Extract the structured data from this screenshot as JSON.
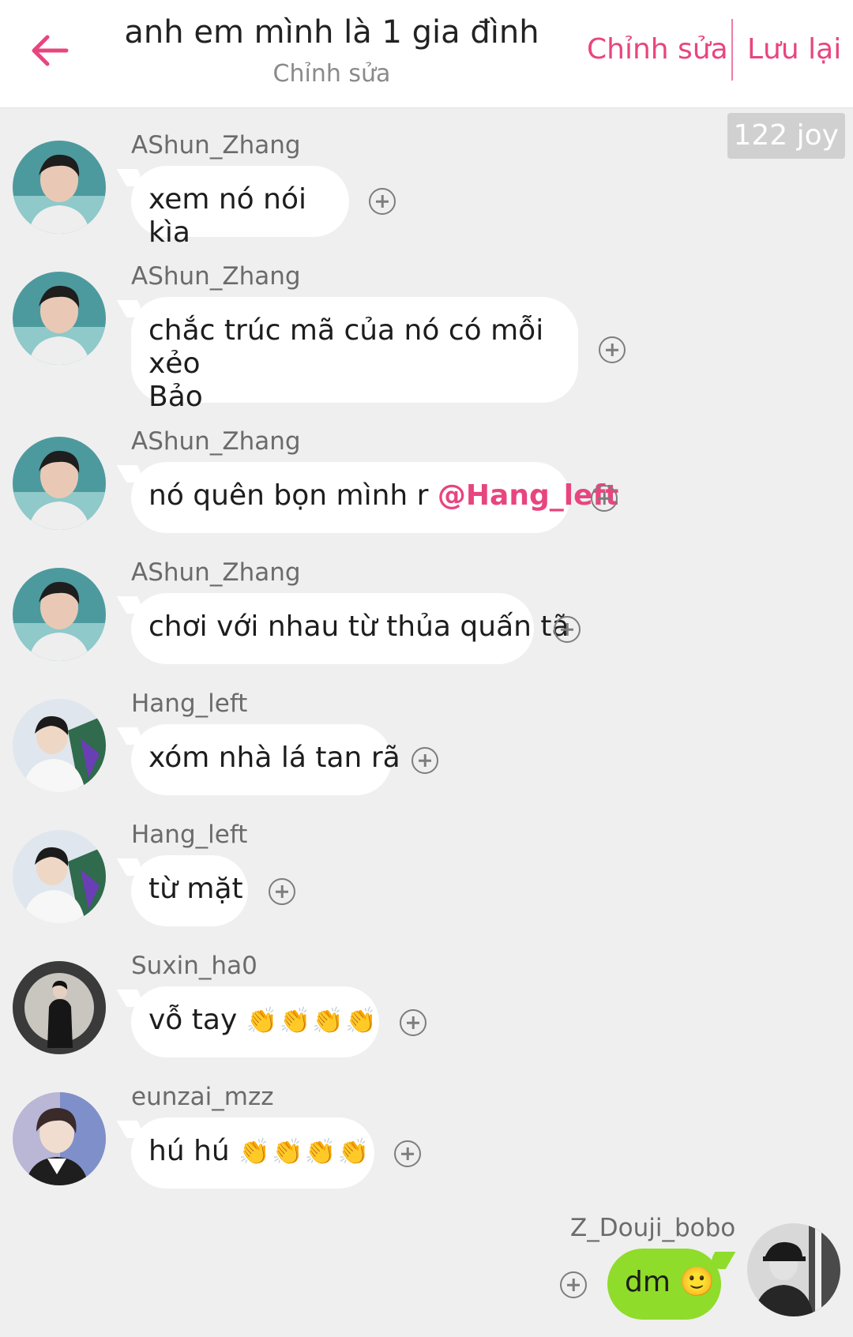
{
  "header": {
    "title": "anh em mình là 1 gia đình",
    "subtitle": "Chỉnh sửa",
    "edit_label": "Chỉnh sửa",
    "save_label": "Lưu lại",
    "back_icon": "arrow-left-icon",
    "accent": "#e8457f"
  },
  "joy_badge": "122 joy",
  "messages": [
    {
      "sender": "AShun_Zhang",
      "text": "xem nó nói kìa"
    },
    {
      "sender": "AShun_Zhang",
      "text_line1": "chắc trúc mã của nó có mỗi xẻo",
      "text_line2": "Bảo"
    },
    {
      "sender": "AShun_Zhang",
      "text": "nó quên bọn mình r",
      "mention": "@Hang_left"
    },
    {
      "sender": "AShun_Zhang",
      "text": "chơi với nhau từ thủa quấn tã"
    },
    {
      "sender": "Hang_left",
      "text": "xóm nhà lá tan rã"
    },
    {
      "sender": "Hang_left",
      "text": "từ mặt"
    },
    {
      "sender": "Suxin_ha0",
      "text": "vỗ tay",
      "emoji": "👏👏👏👏"
    },
    {
      "sender": "eunzai_mzz",
      "text": "hú hú",
      "emoji": "👏👏👏👏"
    },
    {
      "sender": "Z_Douji_bobo",
      "text": "dm",
      "emoji": "🙂",
      "own": true,
      "bubble_color": "#8fdc2a"
    }
  ]
}
